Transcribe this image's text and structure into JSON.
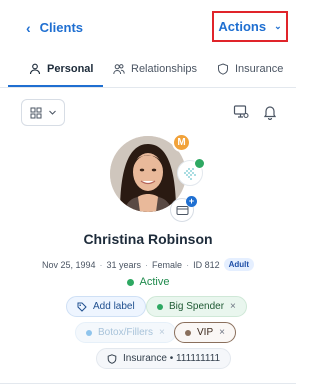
{
  "header": {
    "back_label": "Clients",
    "actions_label": "Actions"
  },
  "tabs": [
    {
      "label": "Personal",
      "icon": "person-icon",
      "active": true
    },
    {
      "label": "Relationships",
      "icon": "people-icon",
      "active": false
    },
    {
      "label": "Insurance",
      "icon": "shield-icon",
      "active": false
    }
  ],
  "toolbar": {
    "view_icon": "grid-icon",
    "caret_icon": "chevron-down-icon",
    "right_icons": [
      "monitor-settings-icon",
      "bell-icon"
    ]
  },
  "profile": {
    "badge_letter": "M",
    "name": "Christina Robinson",
    "dob": "Nov 25, 1994",
    "age": "31 years",
    "gender": "Female",
    "id": "ID 812",
    "category": "Adult",
    "status": "Active"
  },
  "labels": {
    "add_label": "Add label",
    "items": [
      {
        "text": "Big Spender",
        "color": "#2ea862"
      },
      {
        "text": "Botox/Fillers",
        "color": "#8fc4ec"
      },
      {
        "text": "VIP",
        "color": "#8a6f5c"
      }
    ],
    "insurance": "Insurance • 111111111"
  },
  "colors": {
    "accent": "#1f6fd1",
    "highlight_border": "#e0242a",
    "status_green": "#2ea862"
  }
}
